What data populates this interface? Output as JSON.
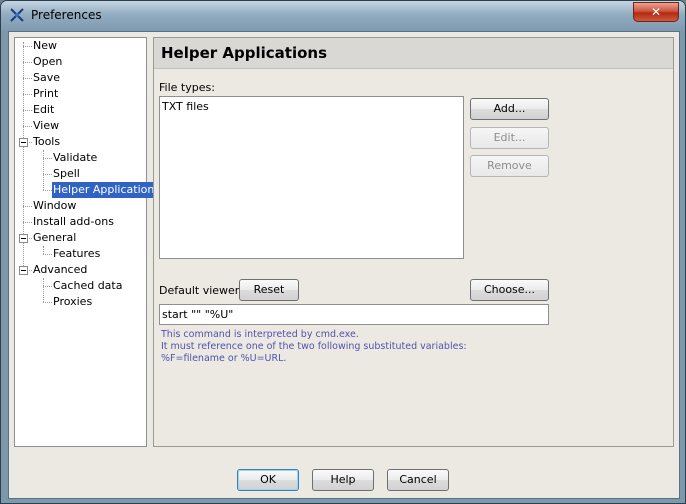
{
  "window": {
    "title": "Preferences",
    "close_label": "✕"
  },
  "tree": {
    "items": [
      {
        "label": "New",
        "level": 1
      },
      {
        "label": "Open",
        "level": 1
      },
      {
        "label": "Save",
        "level": 1
      },
      {
        "label": "Print",
        "level": 1
      },
      {
        "label": "Edit",
        "level": 1
      },
      {
        "label": "View",
        "level": 1
      },
      {
        "label": "Tools",
        "level": 1,
        "expanded": true
      },
      {
        "label": "Validate",
        "level": 2
      },
      {
        "label": "Spell",
        "level": 2
      },
      {
        "label": "Helper Applications",
        "level": 2,
        "selected": true
      },
      {
        "label": "Window",
        "level": 1
      },
      {
        "label": "Install add-ons",
        "level": 1
      },
      {
        "label": "General",
        "level": 1,
        "expanded": true
      },
      {
        "label": "Features",
        "level": 2
      },
      {
        "label": "Advanced",
        "level": 1,
        "expanded": true
      },
      {
        "label": "Cached data",
        "level": 2
      },
      {
        "label": "Proxies",
        "level": 2
      }
    ]
  },
  "panel": {
    "title": "Helper Applications",
    "file_types_label": "File types:",
    "file_types": [
      "TXT files"
    ],
    "add_label": "Add...",
    "edit_label": "Edit...",
    "remove_label": "Remove",
    "default_viewer_label": "Default viewer:",
    "reset_label": "Reset",
    "choose_label": "Choose...",
    "command_value": "start \"\" \"%U\"",
    "hint_lines": [
      "This command is interpreted by cmd.exe.",
      "It must reference one of the two following substituted variables:",
      "%F=filename or %U=URL."
    ]
  },
  "footer": {
    "ok_label": "OK",
    "help_label": "Help",
    "cancel_label": "Cancel"
  }
}
